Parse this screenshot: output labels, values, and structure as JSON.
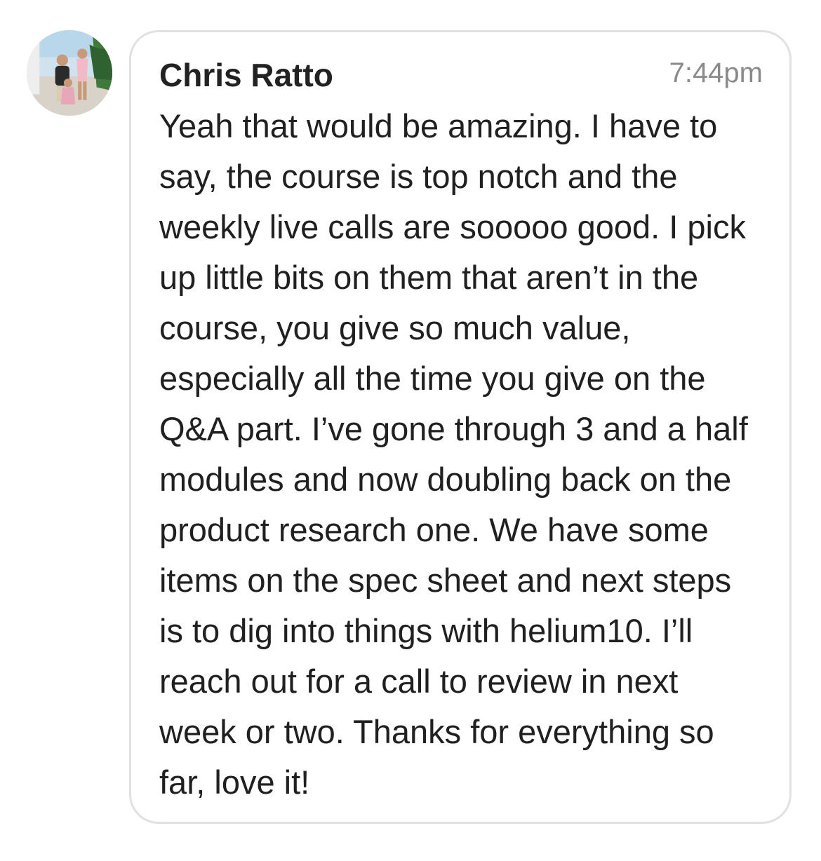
{
  "message": {
    "avatar": {
      "icon": "user-photo-avatar"
    },
    "sender_name": "Chris Ratto",
    "timestamp": "7:44pm",
    "text": "Yeah that would be amazing. I have to say, the course is top notch and the weekly live calls are sooooo good. I pick up little bits on them that aren’t in the course, you give so much value, especially all the time you give on the Q&A part. I’ve gone through 3 and a half modules and now doubling back on the product research one. We have some items on the spec sheet and next steps is to dig into things with helium10. I’ll reach out for a call to review in next week or two. Thanks for everything so far, love it!"
  },
  "colors": {
    "bubble_border": "#e1e1e1",
    "name": "#222222",
    "timestamp": "#8a8a8a",
    "text": "#202020"
  }
}
